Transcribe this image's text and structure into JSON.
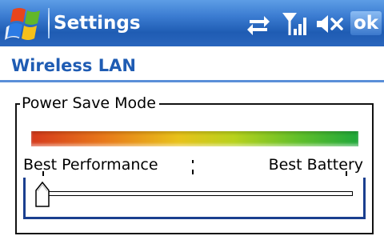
{
  "titlebar": {
    "title": "Settings",
    "ok_label": "ok",
    "icons": [
      "windows-start-icon",
      "connectivity-icon",
      "signal-strength-icon",
      "volume-muted-icon"
    ]
  },
  "page": {
    "title": "Wireless LAN"
  },
  "power_save": {
    "group_label": "Power Save Mode",
    "min_label": "Best Performance",
    "max_label": "Best Battery",
    "slider_value": 0,
    "slider_steps": 3,
    "gradient_colors": [
      "#d63a1c",
      "#e8781a",
      "#e8c21a",
      "#b8d21c",
      "#5fbf2a",
      "#1fa83a"
    ]
  },
  "colors": {
    "titlebar": "#1f5cb3",
    "accent": "#1f5cb3",
    "header_rule": "#5a8fd8",
    "slider_frame": "#1a3f8f"
  }
}
